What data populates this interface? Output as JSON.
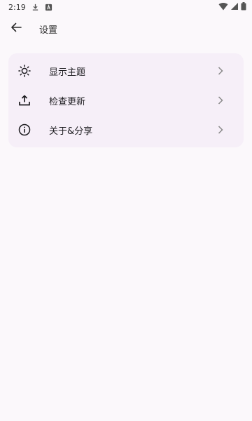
{
  "status_bar": {
    "time": "2:19",
    "icons": [
      "download-icon",
      "app-notification-icon",
      "wifi-icon",
      "cellular-icon",
      "battery-icon"
    ]
  },
  "app_bar": {
    "title": "设置",
    "back_icon": "arrow-left-icon"
  },
  "settings": {
    "items": [
      {
        "label": "显示主题",
        "icon": "brightness-icon"
      },
      {
        "label": "检查更新",
        "icon": "upload-icon"
      },
      {
        "label": "关于&分享",
        "icon": "info-icon"
      }
    ]
  },
  "colors": {
    "background": "#fbf8fb",
    "card": "#f6eff8",
    "text": "#1c1b1f",
    "chevron": "#8a8a8a"
  }
}
